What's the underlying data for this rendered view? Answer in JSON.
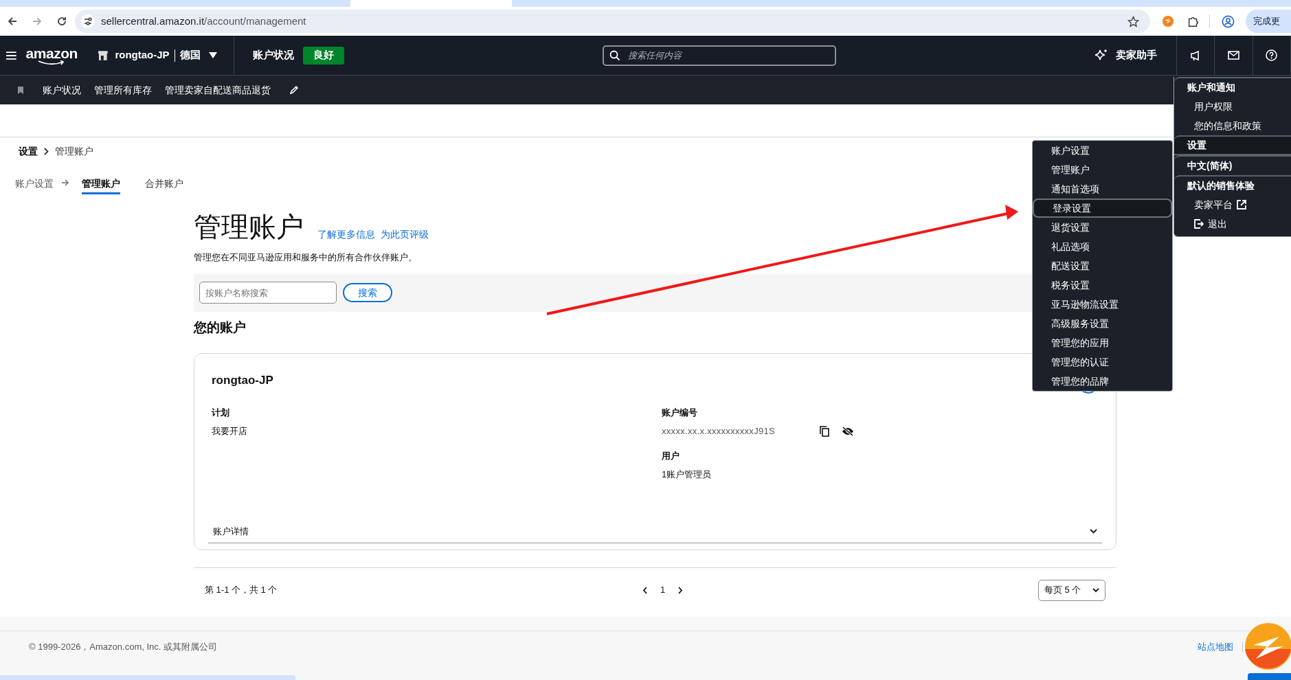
{
  "browser": {
    "url_host": "sellercentral.amazon.it",
    "url_path": "/account/management",
    "update_button": "完成更"
  },
  "header": {
    "logo": "amazon",
    "store": "rongtao-JP",
    "region": "德国",
    "status_label": "账户状况",
    "status_badge": "良好",
    "search": {
      "placeholder": "搜索任何内容"
    },
    "assistant": "卖家助手"
  },
  "quick_links": [
    "账户状况",
    "管理所有库存",
    "管理卖家自配送商品退货"
  ],
  "breadcrumb": [
    "设置",
    "管理账户"
  ],
  "parent_step": "账户设置",
  "tabs": [
    {
      "label": "管理账户",
      "selected": true
    },
    {
      "label": "合并账户",
      "selected": false
    }
  ],
  "page": {
    "title": "管理账户",
    "links": [
      "了解更多信息",
      "为此页评级"
    ],
    "description": "管理您在不同亚马逊应用和服务中的所有合作伙伴账户。"
  },
  "search": {
    "placeholder": "按账户名称搜索",
    "button": "搜索"
  },
  "section_title": "您的账户",
  "accounts": [
    {
      "name": "rongtao-JP",
      "left_fields": [
        {
          "label": "计划",
          "value": "我要开店"
        }
      ],
      "right_fields": [
        {
          "label": "账户编号",
          "value": "xxxxx.xx.x.xxxxxxxxxxJ91S",
          "kind": "masked"
        },
        {
          "label": "用户",
          "value": "1账户管理员",
          "kind": "plain"
        }
      ],
      "details": "账户详情"
    }
  ],
  "pagination": {
    "summary": "第 1-1 个，共 1 个",
    "page": "1",
    "per_page": "每页 5 个"
  },
  "settings_menu": [
    {
      "label": "账户设置",
      "selected": false
    },
    {
      "label": "管理账户",
      "selected": false
    },
    {
      "label": "通知首选项",
      "selected": false
    },
    {
      "label": "登录设置",
      "selected": true
    },
    {
      "label": "退货设置",
      "selected": false
    },
    {
      "label": "礼品选项",
      "selected": false
    },
    {
      "label": "配送设置",
      "selected": false
    },
    {
      "label": "税务设置",
      "selected": false
    },
    {
      "label": "亚马逊物流设置",
      "selected": false
    },
    {
      "label": "高级服务设置",
      "selected": false
    },
    {
      "label": "管理您的应用",
      "selected": false
    },
    {
      "label": "管理您的认证",
      "selected": false
    },
    {
      "label": "管理您的品牌",
      "selected": false
    }
  ],
  "account_menu": [
    {
      "label": "账户和通知",
      "kind": "heading",
      "selected": false
    },
    {
      "label": "用户权限",
      "kind": "link",
      "selected": false
    },
    {
      "label": "您的信息和政策",
      "kind": "link",
      "selected": false
    },
    {
      "label": "设置",
      "kind": "heading",
      "selected": true
    },
    {
      "label": "中文(简体)",
      "kind": "heading",
      "selected": false
    },
    {
      "label": "默认的销售体验",
      "kind": "heading",
      "selected": false
    },
    {
      "label": "卖家平台",
      "kind": "external",
      "selected": false
    },
    {
      "label": "退出",
      "kind": "logout",
      "selected": false
    }
  ],
  "footer": {
    "copyright": "© 1999-2026，Amazon.com, Inc. 或其附属公司",
    "links": [
      "站点地图"
    ]
  }
}
